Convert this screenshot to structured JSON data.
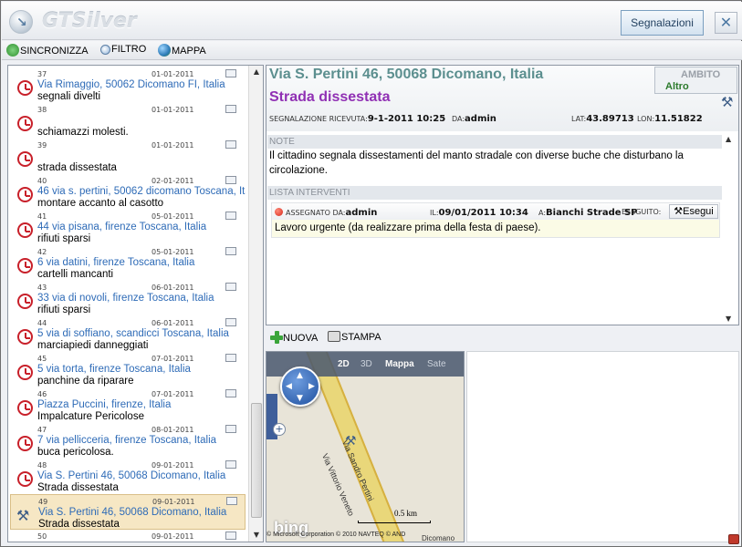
{
  "app": {
    "title": "GTSilver",
    "segnalazioni_label": "Segnalazioni",
    "close_symbol": "✕"
  },
  "toolbar": {
    "sync_label": "SINCRONIZZA",
    "filter_label": "FILTRO",
    "map_label": "MAPPA"
  },
  "list": [
    {
      "num": "37",
      "date": "01-01-2011",
      "addr": "Via Rimaggio, 50062 Dicomano FI, Italia",
      "desc": "segnali divelti"
    },
    {
      "num": "38",
      "date": "01-01-2011",
      "addr": "",
      "desc": "schiamazzi molesti."
    },
    {
      "num": "39",
      "date": "01-01-2011",
      "addr": "",
      "desc": "strada dissestata"
    },
    {
      "num": "40",
      "date": "02-01-2011",
      "addr": "46 via s. pertini, 50062 dicomano Toscana, Italia",
      "desc": "montare accanto al casotto"
    },
    {
      "num": "41",
      "date": "05-01-2011",
      "addr": "44 via pisana, firenze Toscana, Italia",
      "desc": "rifiuti sparsi"
    },
    {
      "num": "42",
      "date": "05-01-2011",
      "addr": "6 via datini, firenze Toscana, Italia",
      "desc": "cartelli mancanti"
    },
    {
      "num": "43",
      "date": "06-01-2011",
      "addr": "33 via di novoli, firenze Toscana, Italia",
      "desc": "rifiuti sparsi"
    },
    {
      "num": "44",
      "date": "06-01-2011",
      "addr": "5 via di soffiano, scandicci Toscana, Italia",
      "desc": "marciapiedi danneggiati"
    },
    {
      "num": "45",
      "date": "07-01-2011",
      "addr": "5 via torta, firenze Toscana, Italia",
      "desc": "panchine da riparare"
    },
    {
      "num": "46",
      "date": "07-01-2011",
      "addr": "Piazza Puccini, firenze, Italia",
      "desc": "Impalcature Pericolose"
    },
    {
      "num": "47",
      "date": "08-01-2011",
      "addr": "7 via pellicceria, firenze Toscana, Italia",
      "desc": "buca pericolosa."
    },
    {
      "num": "48",
      "date": "09-01-2011",
      "addr": "Via S. Pertini 46, 50068 Dicomano, Italia",
      "desc": "Strada dissestata"
    },
    {
      "num": "49",
      "date": "09-01-2011",
      "addr": "Via S. Pertini 46, 50068 Dicomano, Italia",
      "desc": "Strada dissestata"
    },
    {
      "num": "50",
      "date": "09-01-2011",
      "addr": "",
      "desc": ""
    }
  ],
  "detail": {
    "address": "Via S. Pertini 46, 50068 Dicomano, Italia",
    "category": "Strada dissestata",
    "ambito_label": "AMBITO",
    "ambito_value": "Altro",
    "received_label": "SEGNALAZIONE RICEVUTA:",
    "received_value": "9-1-2011 10:25",
    "da_label": "DA:",
    "da_value": "admin",
    "lat_label": "LAT:",
    "lat_value": "43.89713",
    "lon_label": "LON:",
    "lon_value": "11.51822",
    "note_header": "NOTE",
    "note_text": "Il cittadino segnala dissestamenti del manto stradale con diverse buche che disturbano la circolazione.",
    "interventi_header": "LISTA INTERVENTI",
    "intervento": {
      "assegnato_label": "ASSEGNATO DA:",
      "assegnato_value": "admin",
      "il_label": "IL:",
      "il_value": "09/01/2011 10:34",
      "a_label": "A:",
      "a_value": "Bianchi Strade SP",
      "eseguito_label": "ESEGUITO:",
      "esegui_button": "Esegui",
      "text": "Lavoro urgente (da realizzare prima della festa di paese)."
    }
  },
  "toolbar2": {
    "nuova_label": "NUOVA",
    "stampa_label": "STAMPA"
  },
  "map": {
    "mode_2d": "2D",
    "mode_3d": "3D",
    "mode_map": "Mappa",
    "mode_sat": "Sate",
    "road1": "Via Vittorio Veneto",
    "road2": "Via Sandro Pertini",
    "scale": "0.5 km",
    "brand": "bing",
    "copyright": "© Microsoft Corporation  © 2010 NAVTEQ  © AND",
    "place": "Dicomano"
  }
}
